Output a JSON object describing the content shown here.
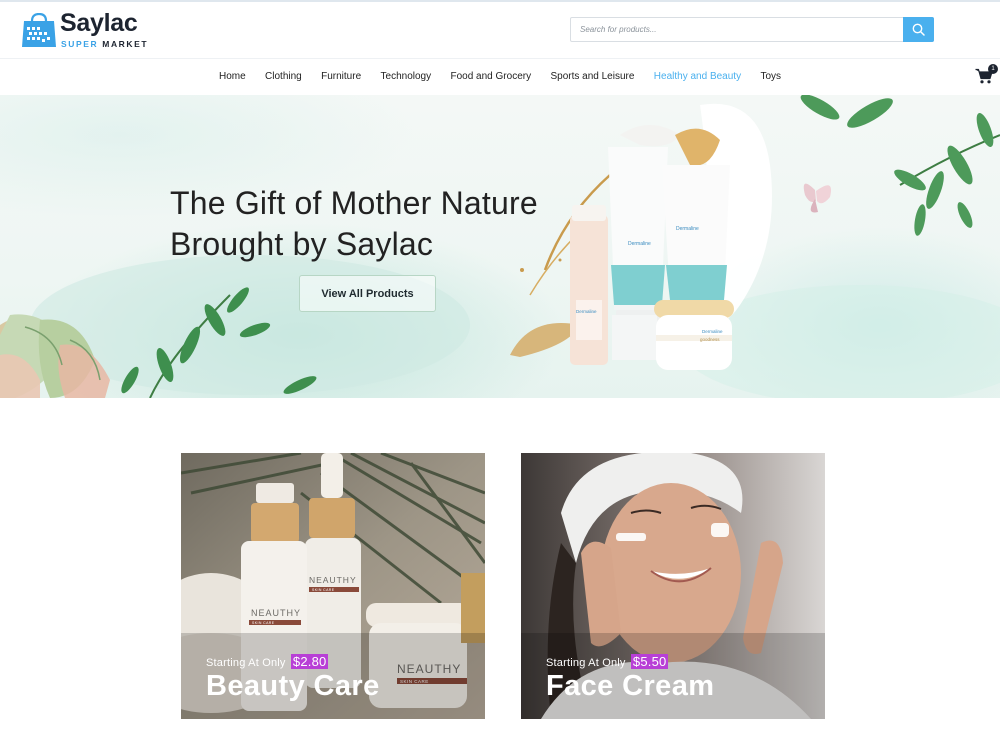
{
  "brand": {
    "name": "Saylac",
    "sub_accent": "SUPER",
    "sub_rest": "MARKET"
  },
  "search": {
    "placeholder": "Search for products..."
  },
  "nav": {
    "items": [
      {
        "label": "Home"
      },
      {
        "label": "Clothing"
      },
      {
        "label": "Furniture"
      },
      {
        "label": "Technology"
      },
      {
        "label": "Food and Grocery"
      },
      {
        "label": "Sports and Leisure"
      },
      {
        "label": "Healthy and Beauty"
      },
      {
        "label": "Toys"
      }
    ],
    "active_item": "Healthy and Beauty",
    "cart_count": "1"
  },
  "hero": {
    "title_line1": "The Gift of Mother Nature",
    "title_line2": "Brought by Saylac",
    "button_label": "View All Products",
    "product_brand": "Dermaline",
    "product_name": "goodness"
  },
  "cards": [
    {
      "starting_text": "Starting At Only",
      "price": "$2.80",
      "name": "Beauty Care",
      "product_brand": "NEAUTHY",
      "product_line": "SKIN CARE"
    },
    {
      "starting_text": "Starting At Only",
      "price": "$5.50",
      "name": "Face Cream"
    }
  ],
  "colors": {
    "accent": "#4ab0ee",
    "price_highlight": "#b83fd6",
    "text_dark": "#1d2430"
  }
}
